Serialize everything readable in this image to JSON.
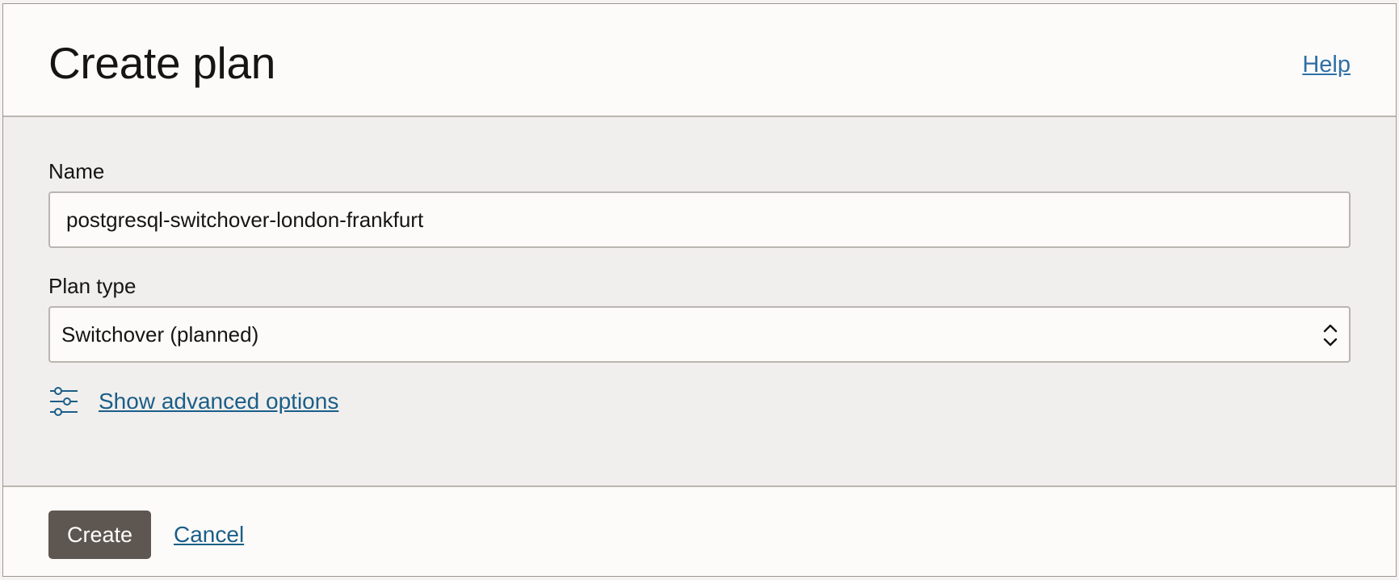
{
  "dialog": {
    "title": "Create plan",
    "help_label": "Help"
  },
  "form": {
    "name": {
      "label": "Name",
      "value": "postgresql-switchover-london-frankfurt"
    },
    "plan_type": {
      "label": "Plan type",
      "selected": "Switchover (planned)"
    },
    "advanced_options_label": "Show advanced options",
    "advanced_options_icon": "sliders-icon"
  },
  "footer": {
    "create_label": "Create",
    "cancel_label": "Cancel"
  },
  "colors": {
    "primary_button": "#5e5650",
    "link": "#1b5e88",
    "help_link": "#2f6fa5",
    "body_background": "#f1efed",
    "header_background": "#fcfbfa"
  }
}
